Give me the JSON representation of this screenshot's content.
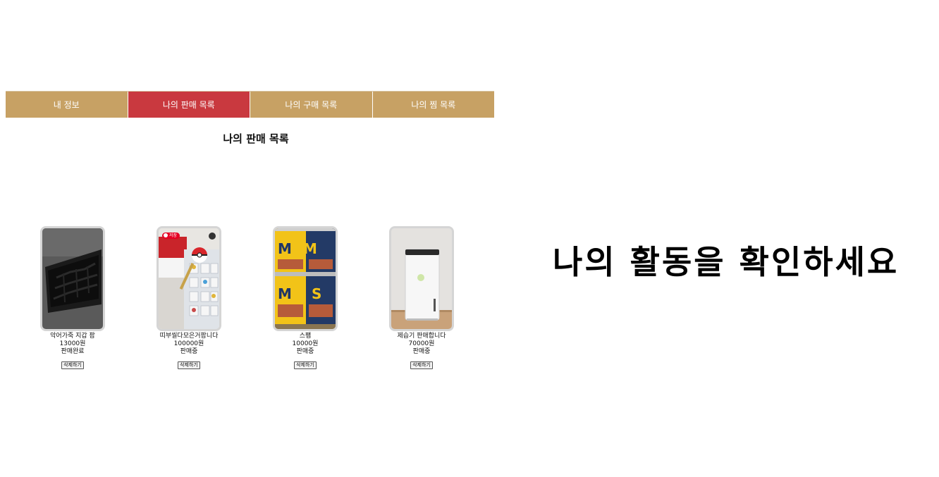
{
  "tabs": [
    {
      "label": "내 정보",
      "active": false
    },
    {
      "label": "나의 판매 목록",
      "active": true
    },
    {
      "label": "나의 구매 목록",
      "active": false
    },
    {
      "label": "나의 찜 목록",
      "active": false
    }
  ],
  "section_title": "나의 판매 목록",
  "products": [
    {
      "name": "악어가죽 지갑 팜",
      "price": "13000원",
      "status": "판매완료",
      "delete_label": "삭제하기",
      "image_icon": "wallet-photo"
    },
    {
      "name": "띠부씰다모은거팜니다",
      "price": "100000원",
      "status": "판매중",
      "delete_label": "삭제하기",
      "image_icon": "sticker-binder-photo",
      "image_badge": "저장"
    },
    {
      "name": "스팸",
      "price": "10000원",
      "status": "판매중",
      "delete_label": "삭제하기",
      "image_icon": "spam-cans-photo"
    },
    {
      "name": "제습기 판매합니다",
      "price": "70000원",
      "status": "판매중",
      "delete_label": "삭제하기",
      "image_icon": "dehumidifier-photo"
    }
  ],
  "headline": "나의 활동을 확인하세요",
  "colors": {
    "tab_bg": "#c7a164",
    "tab_active_bg": "#c9393f",
    "tab_text": "#ffffff"
  }
}
